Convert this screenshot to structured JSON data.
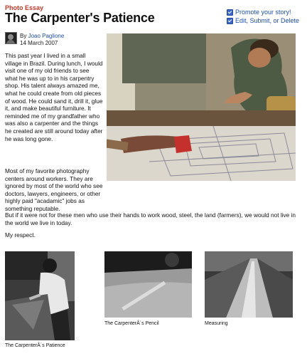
{
  "header": {
    "category": "Photo Essay",
    "title": "The Carpenter's Patience"
  },
  "actions": [
    {
      "label": "Promote your story!"
    },
    {
      "label": "Edit, Submit, or Delete"
    }
  ],
  "byline": {
    "by_prefix": "By",
    "author": "Joao Paglione",
    "date": "14 March 2007"
  },
  "story": {
    "p1": "This past year I lived in a small village in Brazil. During lunch, I would visit one of my old friends to see what he was up to in his carpentry shop. His talent always amazed me, what he could create from old pieces of wood. He could sand it, drill it, glue it, and make beautiful furniture. It reminded me of my grandfather who was also a carpenter and the things he created are still around today after he was long gone.",
    "p2": "Most of my favorite photography centers around workers. They are ignored by most of the world who see doctors, lawyers, engineers, or other highly paid \"acadamic\" jobs as something reputable.",
    "p3": "But if it were not for these men who use their hands to work wood, steel, the land (farmers), we would not live in the world we live in today.",
    "p4": "My respect."
  },
  "thumbnails": [
    {
      "caption": "The CarpenterÂ´s Patience"
    },
    {
      "caption": "The CarpenterÂ´s Pencil"
    },
    {
      "caption": "Measuring"
    }
  ],
  "colors": {
    "category_red": "#c0392b",
    "link_blue": "#1f4fa8",
    "checkbox_blue": "#3a66c6"
  },
  "icons": {
    "action_marker": "checkbox-icon"
  }
}
